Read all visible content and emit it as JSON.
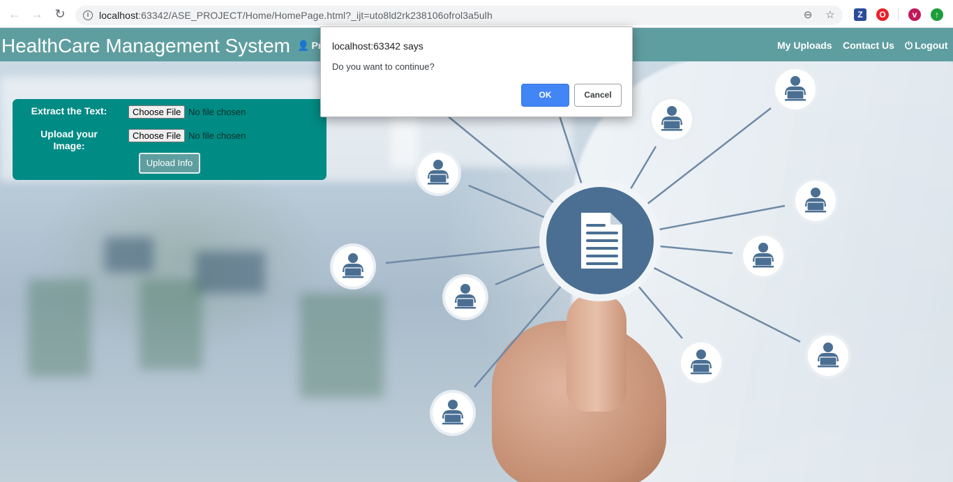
{
  "browser": {
    "url_host": "localhost",
    "url_rest": ":63342/ASE_PROJECT/Home/HomePage.html?_ijt=uto8ld2rk238106ofrol3a5ulh",
    "back_icon": "←",
    "forward_icon": "→",
    "reload_icon": "↻",
    "info_icon": "i",
    "zoom_icon": "⊖",
    "bookmark_icon": "☆",
    "extensions": [
      {
        "label": "Z",
        "color": "#2a4b9b"
      },
      {
        "label": "O",
        "color": "#e8202a"
      },
      {
        "label": "v",
        "color": "#c2185b"
      },
      {
        "label": "↑",
        "color": "#1e9e3a"
      }
    ]
  },
  "header": {
    "title": "HealthCare Management System",
    "profile_icon": "👤",
    "profile_label": "Pro",
    "my_uploads": "My Uploads",
    "contact_us": "Contact Us",
    "logout_icon": "⏻",
    "logout": "Logout",
    "bar_color": "#5f9ea0"
  },
  "upload_form": {
    "extract_label": "Extract the Text:",
    "image_label_line1": "Upload your",
    "image_label_line2": "Image:",
    "choose_file_label": "Choose File",
    "no_file_text": "No file chosen",
    "upload_button": "Upload Info",
    "card_color": "#008b84"
  },
  "dialog": {
    "title": "localhost:63342 says",
    "message": "Do you want to continue?",
    "ok_label": "OK",
    "cancel_label": "Cancel"
  }
}
